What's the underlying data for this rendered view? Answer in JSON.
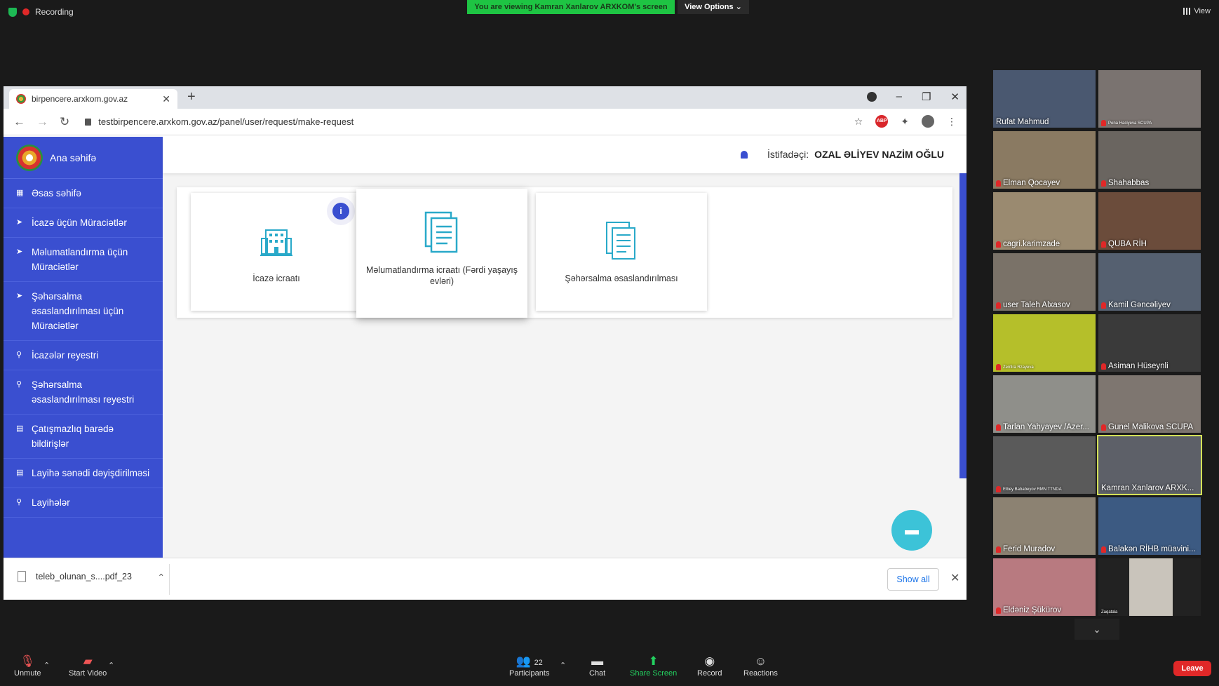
{
  "zoom": {
    "recording_label": "Recording",
    "viewing_banner": "You are viewing Kamran Xanlarov ARXKOM's screen",
    "view_options_label": "View Options",
    "view_label": "View",
    "toolbar": {
      "unmute": "Unmute",
      "start_video": "Start Video",
      "participants": "Participants",
      "participants_count": "22",
      "chat": "Chat",
      "share_screen": "Share Screen",
      "record": "Record",
      "reactions": "Reactions",
      "leave": "Leave"
    },
    "participants": [
      {
        "name": "Rufat Mahmud",
        "muted": false
      },
      {
        "name": "Pena Haciyeva SCUPA",
        "muted": true
      },
      {
        "name": "Elman Qocayev",
        "muted": true
      },
      {
        "name": "Shahabbas",
        "muted": true
      },
      {
        "name": "cagri.karimzade",
        "muted": true
      },
      {
        "name": "QUBA RİH",
        "muted": true
      },
      {
        "name": "user Taleh Alxasov",
        "muted": true
      },
      {
        "name": "Kamil Gəncəliyev",
        "muted": true
      },
      {
        "name": "Zenfira Rzayeva",
        "muted": true
      },
      {
        "name": "Asiman Hüseynli",
        "muted": true
      },
      {
        "name": "Tarlan Yahyayev /Azer...",
        "muted": true
      },
      {
        "name": "Gunel Malikova SCUPA",
        "muted": true
      },
      {
        "name": "Elbey Bababeyov RMN TTNDA",
        "muted": true
      },
      {
        "name": "Kamran Xanlarov ARXK...",
        "muted": false
      },
      {
        "name": "Ferid Muradov",
        "muted": true
      },
      {
        "name": "Balakən RİHB müavini...",
        "muted": true
      },
      {
        "name": "Eldəniz Şükürov",
        "muted": true
      },
      {
        "name": "Zaqatala",
        "muted": false
      }
    ]
  },
  "browser": {
    "tab_title": "birpencere.arxkom.gov.az",
    "url": "testbirpencere.arxkom.gov.az/panel/user/request/make-request",
    "abp_label": "ABP"
  },
  "site": {
    "brand": "Ana səhifə",
    "user_label": "İstifadəçi:",
    "user_name": "OZAL ƏLİYEV NAZİM OĞLU",
    "nav": [
      {
        "label": "Əsas səhifə",
        "icon": "grid-icon"
      },
      {
        "label": "İcazə üçün Müraciətlər",
        "icon": "send-icon"
      },
      {
        "label": "Məlumatlandırma üçün Müraciətlər",
        "icon": "send-icon"
      },
      {
        "label": "Şəhərsalma əsaslandırılması üçün Müraciətlər",
        "icon": "send-icon"
      },
      {
        "label": "İcazələr reyestri",
        "icon": "search-icon"
      },
      {
        "label": "Şəhərsalma əsaslandırılması reyestri",
        "icon": "search-icon"
      },
      {
        "label": "Çatışmazlıq barədə bildirişlər",
        "icon": "document-icon"
      },
      {
        "label": "Layihə sənədi dəyişdirilməsi",
        "icon": "document-icon"
      },
      {
        "label": "Layihələr",
        "icon": "search-icon"
      }
    ],
    "cards": [
      {
        "label": "İcazə icraatı"
      },
      {
        "label": "Məlumatlandırma icraatı (Fərdi yaşayış evləri)"
      },
      {
        "label": "Şəhərsalma əsaslandırılması"
      }
    ],
    "info_glyph": "i"
  },
  "download": {
    "file_name": "teleb_olunan_s....pdf_23",
    "show_all": "Show all"
  }
}
